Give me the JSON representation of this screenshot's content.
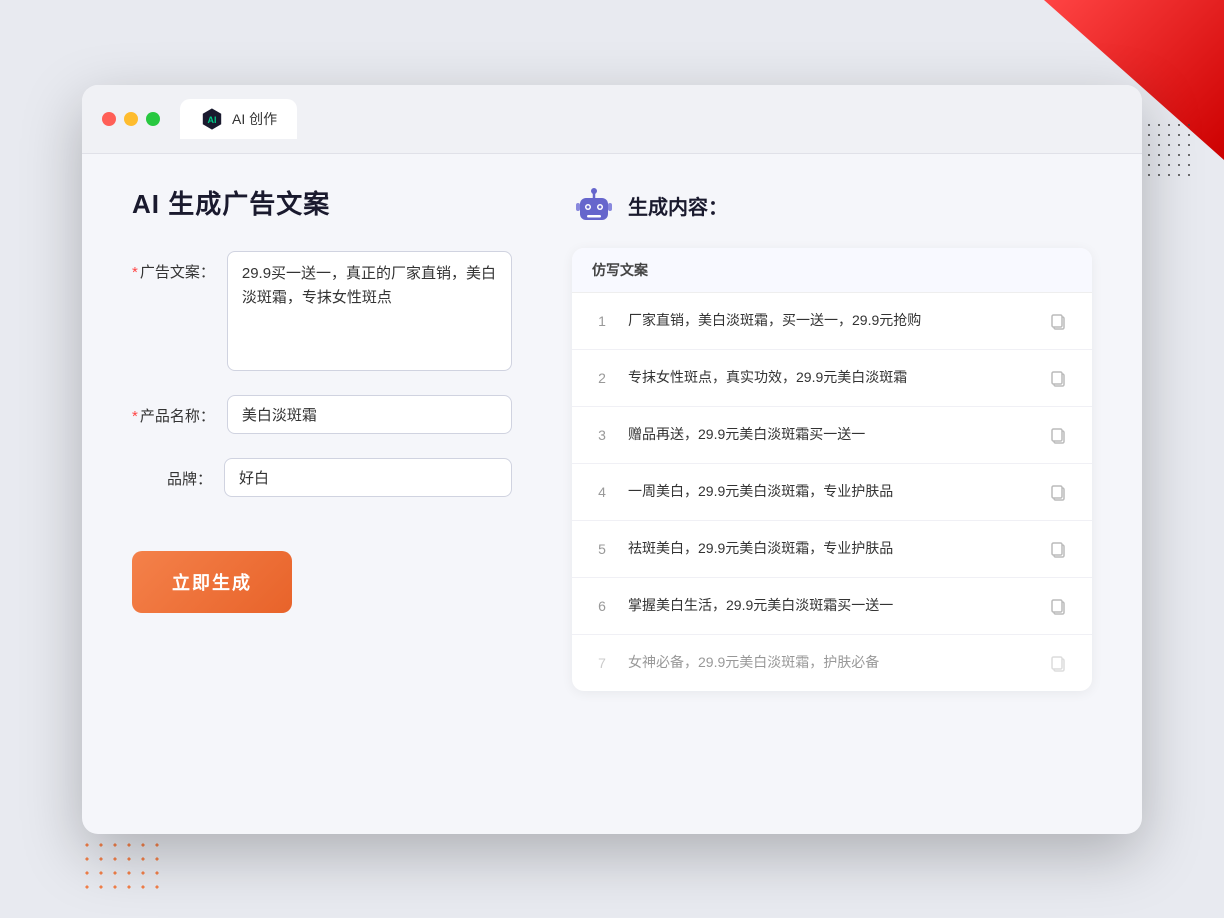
{
  "browser": {
    "tab_label": "AI 创作"
  },
  "left": {
    "title": "AI 生成广告文案",
    "fields": [
      {
        "id": "ad_copy",
        "label": "广告文案：",
        "required": true,
        "type": "textarea",
        "value": "29.9买一送一，真正的厂家直销，美白淡斑霜，专抹女性斑点"
      },
      {
        "id": "product_name",
        "label": "产品名称：",
        "required": true,
        "type": "input",
        "value": "美白淡斑霜"
      },
      {
        "id": "brand",
        "label": "品牌：",
        "required": false,
        "type": "input",
        "value": "好白"
      }
    ],
    "generate_button": "立即生成"
  },
  "right": {
    "header": "生成内容：",
    "table_header": "仿写文案",
    "results": [
      {
        "num": 1,
        "text": "厂家直销，美白淡斑霜，买一送一，29.9元抢购"
      },
      {
        "num": 2,
        "text": "专抹女性斑点，真实功效，29.9元美白淡斑霜"
      },
      {
        "num": 3,
        "text": "赠品再送，29.9元美白淡斑霜买一送一"
      },
      {
        "num": 4,
        "text": "一周美白，29.9元美白淡斑霜，专业护肤品"
      },
      {
        "num": 5,
        "text": "祛斑美白，29.9元美白淡斑霜，专业护肤品"
      },
      {
        "num": 6,
        "text": "掌握美白生活，29.9元美白淡斑霜买一送一"
      },
      {
        "num": 7,
        "text": "女神必备，29.9元美白淡斑霜，护肤必备"
      }
    ]
  },
  "colors": {
    "accent_orange": "#f4814a",
    "accent_purple": "#6666cc",
    "required_red": "#ff4444"
  }
}
